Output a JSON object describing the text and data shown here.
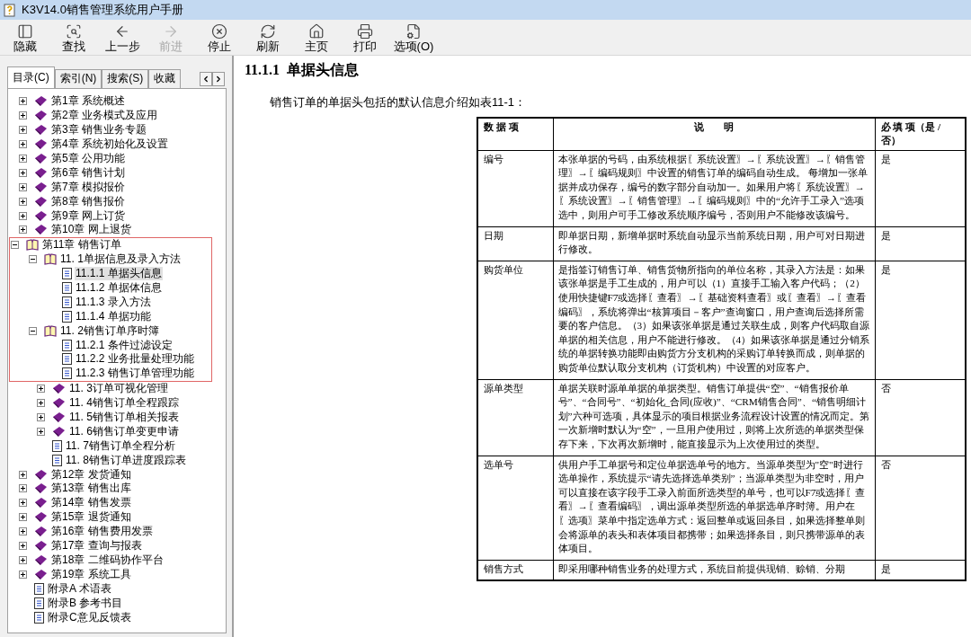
{
  "window": {
    "title": "K3V14.0销售管理系统用户手册"
  },
  "toolbar": [
    {
      "kind": "hide",
      "label": "隐藏",
      "disabled": false
    },
    {
      "kind": "find",
      "label": "查找",
      "disabled": false
    },
    {
      "kind": "back",
      "label": "上一步",
      "disabled": false
    },
    {
      "kind": "forward",
      "label": "前进",
      "disabled": true
    },
    {
      "kind": "stop",
      "label": "停止",
      "disabled": false
    },
    {
      "kind": "refresh",
      "label": "刷新",
      "disabled": false
    },
    {
      "kind": "home",
      "label": "主页",
      "disabled": false
    },
    {
      "kind": "print",
      "label": "打印",
      "disabled": false
    },
    {
      "kind": "options",
      "label": "选项(O)",
      "disabled": false
    }
  ],
  "nav_tabs": [
    {
      "label": "目录(C)",
      "selected": true
    },
    {
      "label": "索引(N)",
      "selected": false
    },
    {
      "label": "搜索(S)",
      "selected": false
    },
    {
      "label": "收藏",
      "selected": false
    }
  ],
  "tree": [
    {
      "label": "第1章 系统概述",
      "kind": "book",
      "expanded": false,
      "selected": false,
      "framed": false
    },
    {
      "label": "第2章 业务模式及应用",
      "kind": "book",
      "expanded": false,
      "selected": false,
      "framed": false
    },
    {
      "label": "第3章 销售业务专题",
      "kind": "book",
      "expanded": false,
      "selected": false,
      "framed": false
    },
    {
      "label": "第4章 系统初始化及设置",
      "kind": "book",
      "expanded": false,
      "selected": false,
      "framed": false
    },
    {
      "label": "第5章 公用功能",
      "kind": "book",
      "expanded": false,
      "selected": false,
      "framed": false
    },
    {
      "label": "第6章 销售计划",
      "kind": "book",
      "expanded": false,
      "selected": false,
      "framed": false
    },
    {
      "label": "第7章 模拟报价",
      "kind": "book",
      "expanded": false,
      "selected": false,
      "framed": false
    },
    {
      "label": "第8章 销售报价",
      "kind": "book",
      "expanded": false,
      "selected": false,
      "framed": false
    },
    {
      "label": "第9章 网上订货",
      "kind": "book",
      "expanded": false,
      "selected": false,
      "framed": false
    },
    {
      "label": "第10章 网上退货",
      "kind": "book",
      "expanded": false,
      "selected": false,
      "framed": false
    },
    {
      "label": "第11章 销售订单",
      "kind": "book",
      "expanded": true,
      "selected": false,
      "framed": true,
      "children": [
        {
          "label": "11. 1单据信息及录入方法",
          "kind": "book",
          "expanded": true,
          "selected": false,
          "children": [
            {
              "label": "11.1.1 单据头信息",
              "kind": "page",
              "selected": true
            },
            {
              "label": "11.1.2 单据体信息",
              "kind": "page",
              "selected": false
            },
            {
              "label": "11.1.3 录入方法",
              "kind": "page",
              "selected": false
            },
            {
              "label": "11.1.4 单据功能",
              "kind": "page",
              "selected": false
            }
          ]
        },
        {
          "label": "11. 2销售订单序时簿",
          "kind": "book",
          "expanded": true,
          "selected": false,
          "children": [
            {
              "label": "11.2.1 条件过滤设定",
              "kind": "page",
              "selected": false
            },
            {
              "label": "11.2.2 业务批量处理功能",
              "kind": "page",
              "selected": false
            },
            {
              "label": "11.2.3 销售订单管理功能",
              "kind": "page",
              "selected": false
            }
          ]
        },
        {
          "label": "11. 3订单可视化管理",
          "kind": "book",
          "expanded": false,
          "selected": false
        },
        {
          "label": "11. 4销售订单全程跟踪",
          "kind": "book",
          "expanded": false,
          "selected": false
        },
        {
          "label": "11. 5销售订单相关报表",
          "kind": "book",
          "expanded": false,
          "selected": false
        },
        {
          "label": "11. 6销售订单变更申请",
          "kind": "book",
          "expanded": false,
          "selected": false
        },
        {
          "label": "11. 7销售订单全程分析",
          "kind": "page",
          "selected": false
        },
        {
          "label": "11. 8销售订单进度跟踪表",
          "kind": "page",
          "selected": false
        }
      ]
    },
    {
      "label": "第12章 发货通知",
      "kind": "book",
      "expanded": false,
      "selected": false,
      "framed": false
    },
    {
      "label": "第13章 销售出库",
      "kind": "book",
      "expanded": false,
      "selected": false,
      "framed": false
    },
    {
      "label": "第14章 销售发票",
      "kind": "book",
      "expanded": false,
      "selected": false,
      "framed": false
    },
    {
      "label": "第15章 退货通知",
      "kind": "book",
      "expanded": false,
      "selected": false,
      "framed": false
    },
    {
      "label": "第16章 销售费用发票",
      "kind": "book",
      "expanded": false,
      "selected": false,
      "framed": false
    },
    {
      "label": "第17章 查询与报表",
      "kind": "book",
      "expanded": false,
      "selected": false,
      "framed": false
    },
    {
      "label": "第18章 二维码协作平台",
      "kind": "book",
      "expanded": false,
      "selected": false,
      "framed": false
    },
    {
      "label": "第19章 系统工具",
      "kind": "book",
      "expanded": false,
      "selected": false,
      "framed": false
    },
    {
      "label": "附录A 术语表",
      "kind": "page",
      "selected": false,
      "framed": false
    },
    {
      "label": "附录B 参考书目",
      "kind": "page",
      "selected": false,
      "framed": false
    },
    {
      "label": "附录C意见反馈表",
      "kind": "page",
      "selected": false,
      "framed": false
    }
  ],
  "content": {
    "heading_number": "11.1.1",
    "heading": "单据头信息",
    "intro": "销售订单的单据头包括的默认信息介绍如表11-1：",
    "table": {
      "columns": [
        "数 据 项",
        "说　　明",
        "必 填 项（是 / 否）"
      ],
      "rows": [
        {
          "item": "编号",
          "description": "本张单据的号码，由系统根据〖系统设置〗→〖系统设置〗→〖销售管理〗→〖编码规则〗中设置的销售订单的编码自动生成。 每增加一张单据并成功保存，编号的数字部分自动加一。如果用户将〖系统设置〗→〖系统设置〗→〖销售管理〗→〖编码规则〗中的“允许手工录入”选项选中，则用户可手工修改系统顺序编号，否则用户不能修改该编号。",
          "required": "是"
        },
        {
          "item": "日期",
          "description": "即单据日期，新增单据时系统自动显示当前系统日期，用户可对日期进行修改。",
          "required": "是"
        },
        {
          "item": "购货单位",
          "description": "是指签订销售订单、销售货物所指向的单位名称，其录入方法是：如果该张单据是手工生成的，用户可以（1）直接手工输入客户代码；（2）使用快捷键F7或选择〖查看〗→〖基础资料查看〗或〖查看〗→〖查看编码〗，系统将弹出“核算项目－客户”查询窗口，用户查询后选择所需要的客户信息。（3）如果该张单据是通过关联生成，则客户代码取自源单据的相关信息，用户不能进行修改。（4）如果该张单据是通过分销系统的单据转换功能即由购货方分支机构的采购订单转换而成，则单据的购货单位默认取分支机构（订货机构）中设置的对应客户。",
          "required": "是"
        },
        {
          "item": "源单类型",
          "description": "单据关联时源单单据的单据类型。销售订单提供“空”、“销售报价单号”、“合同号”、“初始化_合同(应收)”、“CRM销售合同”、“销售明细计划”六种可选项，具体显示的项目根据业务流程设计设置的情况而定。第一次新增时默认为“空”，一旦用户使用过，则将上次所选的单据类型保存下来，下次再次新增时，能直接显示为上次使用过的类型。",
          "required": "否"
        },
        {
          "item": "选单号",
          "description": "供用户手工单据号和定位单据选单号的地方。当源单类型为\"空\"时进行选单操作，系统提示“请先选择选单类别”；当源单类型为非空时，用户可以直接在该字段手工录入前面所选类型的单号，也可以F7或选择〖查看〗→〖查看编码〗，调出源单类型所选的单据选单序时簿。用户在〖选项〗菜单中指定选单方式：返回整单或返回条目，如果选择整单则会将源单的表头和表体项目都携带；如果选择条目，则只携带源单的表体项目。",
          "required": "否"
        },
        {
          "item": "销售方式",
          "description": "即采用哪种销售业务的处理方式，系统目前提供现销、赊销、分期",
          "required": "是"
        }
      ]
    }
  }
}
